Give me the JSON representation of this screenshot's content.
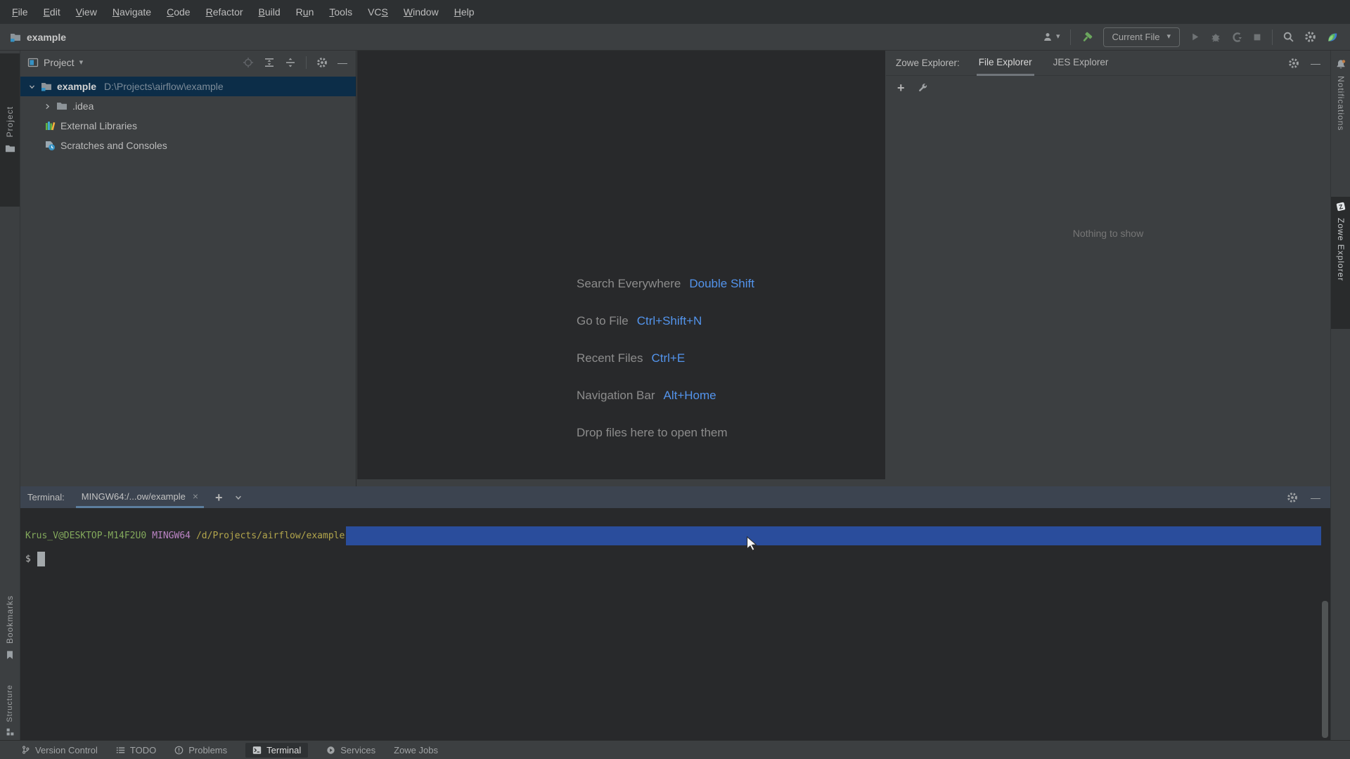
{
  "colors": {
    "chrome": "#3c3f41",
    "editor_bg": "#28292b",
    "menu_bg": "#2d3032",
    "tree_selection": "#0c2d48",
    "link_blue": "#5394ec",
    "terminal_selection": "#2a4d9c",
    "terminal_green": "#83a95c",
    "terminal_purple": "#bc85c5",
    "terminal_yellow": "#b3a64c",
    "build_hammer_green": "#6ba65d",
    "terminal_tab_underline": "#5c7e9e"
  },
  "glyphs": {
    "caret_down": "▾",
    "plus": "+",
    "minus": "—",
    "close": "×"
  },
  "menu_bar": {
    "items": [
      {
        "pre": "",
        "key": "F",
        "post": "ile"
      },
      {
        "pre": "",
        "key": "E",
        "post": "dit"
      },
      {
        "pre": "",
        "key": "V",
        "post": "iew"
      },
      {
        "pre": "",
        "key": "N",
        "post": "avigate"
      },
      {
        "pre": "",
        "key": "C",
        "post": "ode"
      },
      {
        "pre": "",
        "key": "R",
        "post": "efactor"
      },
      {
        "pre": "",
        "key": "B",
        "post": "uild"
      },
      {
        "pre": "R",
        "key": "u",
        "post": "n"
      },
      {
        "pre": "",
        "key": "T",
        "post": "ools"
      },
      {
        "pre": "VC",
        "key": "S",
        "post": ""
      },
      {
        "pre": "",
        "key": "W",
        "post": "indow"
      },
      {
        "pre": "",
        "key": "H",
        "post": "elp"
      }
    ]
  },
  "header": {
    "project_name": "example",
    "run_config": "Current File"
  },
  "left_strip": {
    "project": "Project",
    "bookmarks": "Bookmarks",
    "structure": "Structure"
  },
  "right_strip": {
    "notifications": "Notifications",
    "zowe_explorer": "Zowe Explorer"
  },
  "project_panel": {
    "title": "Project",
    "tree": {
      "root_name": "example",
      "root_path": "D:\\Projects\\airflow\\example",
      "idea_folder": ".idea",
      "external_libraries": "External Libraries",
      "scratches": "Scratches and Consoles"
    }
  },
  "editor_hints": {
    "lines": [
      {
        "label": "Search Everywhere",
        "keys": "Double Shift"
      },
      {
        "label": "Go to File",
        "keys": "Ctrl+Shift+N"
      },
      {
        "label": "Recent Files",
        "keys": "Ctrl+E"
      },
      {
        "label": "Navigation Bar",
        "keys": "Alt+Home"
      }
    ],
    "drop_hint": "Drop files here to open them"
  },
  "zowe_panel": {
    "label": "Zowe Explorer:",
    "tabs": [
      {
        "label": "File Explorer"
      },
      {
        "label": "JES Explorer"
      }
    ],
    "empty_text": "Nothing to show"
  },
  "terminal": {
    "label": "Terminal:",
    "tab_title": "MINGW64:/...ow/example",
    "prompt_user": "Krus_V@DESKTOP-M14F2U0",
    "prompt_env": "MINGW64",
    "prompt_path": "/d/Projects/airflow/example",
    "prompt_symbol": "$"
  },
  "status_bar": {
    "items": [
      {
        "label": "Version Control"
      },
      {
        "label": "TODO"
      },
      {
        "label": "Problems"
      },
      {
        "label": "Terminal"
      },
      {
        "label": "Services"
      },
      {
        "label": "Zowe Jobs"
      }
    ]
  }
}
